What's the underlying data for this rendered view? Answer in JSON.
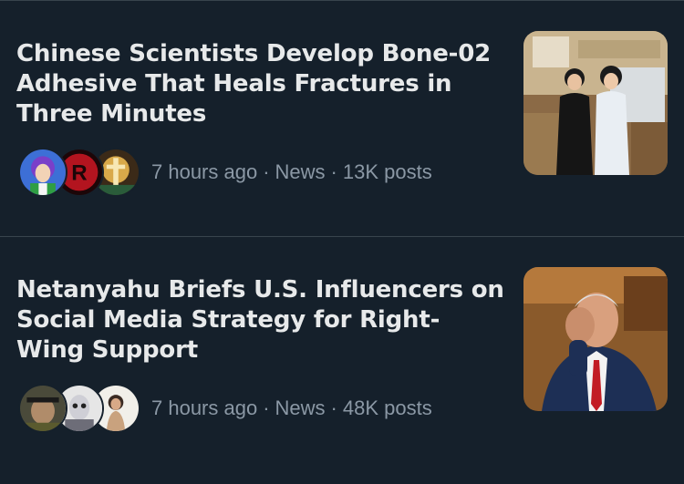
{
  "stories": [
    {
      "headline": "Chinese Scientists Develop Bone-02 Adhesive That Heals Fractures in Three Minutes",
      "time": "7 hours ago",
      "category": "News",
      "posts": "13K posts",
      "avatars": [
        "anime-character-avatar",
        "red-logo-avatar",
        "religious-art-avatar"
      ],
      "thumbnail": "two-scientists-in-lab-photo"
    },
    {
      "headline": "Netanyahu Briefs U.S. Influencers on Social Media Strategy for Right-Wing Support",
      "time": "7 hours ago",
      "category": "News",
      "posts": "48K posts",
      "avatars": [
        "censored-soldier-avatar",
        "costumed-person-avatar",
        "woman-photo-avatar"
      ],
      "thumbnail": "man-with-hand-on-face-photo"
    }
  ],
  "separator": "·",
  "colors": {
    "background": "#15202b",
    "text_primary": "#e7e9ea",
    "text_secondary": "#8b98a5",
    "divider": "#38444d"
  }
}
